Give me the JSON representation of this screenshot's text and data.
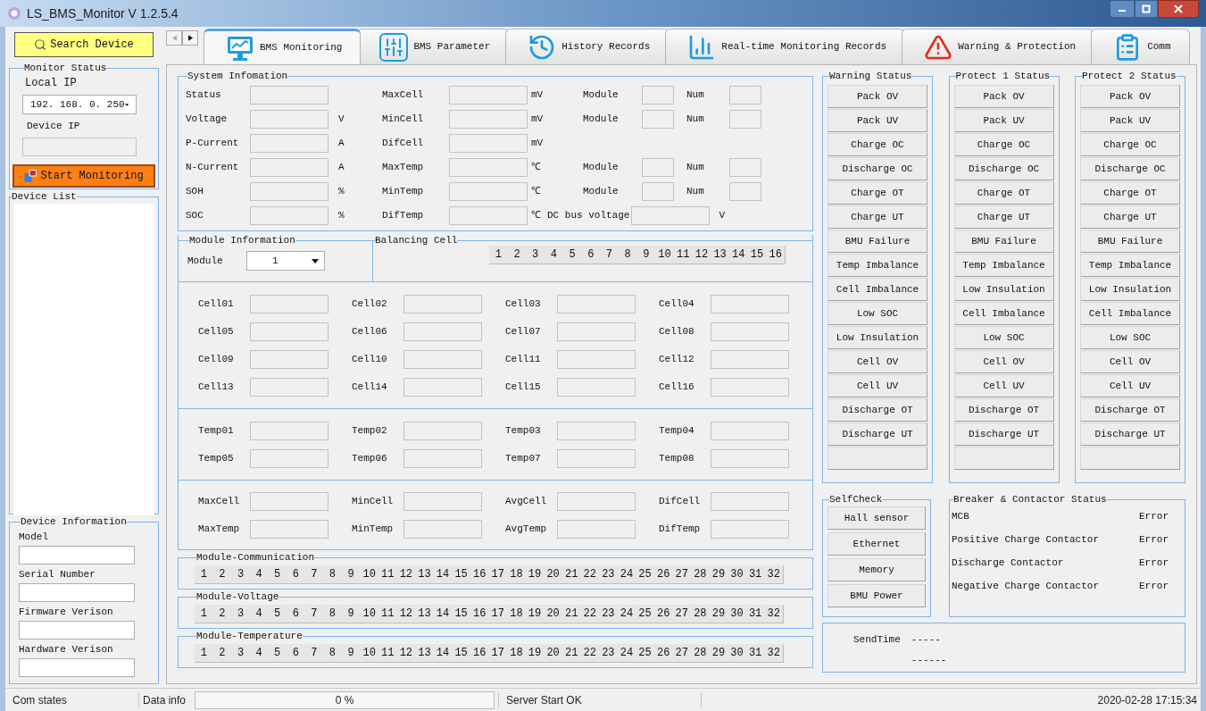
{
  "window": {
    "title": "LS_BMS_Monitor V 1.2.5.4"
  },
  "sidebar": {
    "search_button": "Search Device",
    "monitor_status": {
      "title": "Monitor Status",
      "local_ip_label": "Local IP",
      "local_ip": "192. 168. 0. 250",
      "device_ip_label": "Device IP",
      "start_button": "Start Monitoring"
    },
    "device_list": {
      "title": "Device List"
    },
    "device_information": {
      "title": "Device Information",
      "fields": [
        "Model",
        "Serial Number",
        "Firmware Verison",
        "Hardware Verison"
      ]
    }
  },
  "tabs": [
    {
      "label": "BMS Monitoring",
      "kind": "monitor",
      "selected": true
    },
    {
      "label": "BMS Parameter",
      "kind": "sliders",
      "selected": false
    },
    {
      "label": "History Records",
      "kind": "clock",
      "selected": false
    },
    {
      "label": "Real-time Monitoring Records",
      "kind": "chart",
      "selected": false
    },
    {
      "label": "Warning & Protection",
      "kind": "warning",
      "selected": false
    },
    {
      "label": "Comm",
      "kind": "clipboard",
      "selected": false
    }
  ],
  "system_information": {
    "title": "System Infomation",
    "rows": [
      {
        "label": "Status",
        "label_2": "MaxCell",
        "unit_2": "mV",
        "module_label": "Module",
        "num_label": "Num"
      },
      {
        "label": "Voltage",
        "unit": "V",
        "label_2": "MinCell",
        "unit_2": "mV",
        "module_label": "Module",
        "num_label": "Num"
      },
      {
        "label": "P-Current",
        "unit": "A",
        "label_2": "DifCell",
        "unit_2": "mV"
      },
      {
        "label": "N-Current",
        "unit": "A",
        "label_2": "MaxTemp",
        "unit_2": "℃",
        "module_label": "Module",
        "num_label": "Num"
      },
      {
        "label": "SOH",
        "unit": "%",
        "label_2": "MinTemp",
        "unit_2": "℃",
        "module_label": "Module",
        "num_label": "Num"
      },
      {
        "label": "SOC",
        "unit": "%",
        "label_2": "DifTemp",
        "unit_2": "℃",
        "bus_label": "DC bus voltage",
        "bus_unit": "V"
      }
    ]
  },
  "module_information": {
    "title": "Module Information",
    "module_label": "Module",
    "module_value": "1"
  },
  "balancing_cell": {
    "title": "Balancing Cell",
    "cells": [
      "1",
      "2",
      "3",
      "4",
      "5",
      "6",
      "7",
      "8",
      "9",
      "10",
      "11",
      "12",
      "13",
      "14",
      "15",
      "16"
    ]
  },
  "cells": [
    "Cell01",
    "Cell02",
    "Cell03",
    "Cell04",
    "Cell05",
    "Cell06",
    "Cell07",
    "Cell08",
    "Cell09",
    "Cell10",
    "Cell11",
    "Cell12",
    "Cell13",
    "Cell14",
    "Cell15",
    "Cell16"
  ],
  "temps": [
    "Temp01",
    "Temp02",
    "Temp03",
    "Temp04",
    "Temp05",
    "Temp06",
    "Temp07",
    "Temp08"
  ],
  "summary": [
    "MaxCell",
    "MinCell",
    "AvgCell",
    "DifCell",
    "MaxTemp",
    "MinTemp",
    "AvgTemp",
    "DifTemp"
  ],
  "module_strips": [
    {
      "title": "Module-Communication",
      "numbers": [
        "1",
        "2",
        "3",
        "4",
        "5",
        "6",
        "7",
        "8",
        "9",
        "10",
        "11",
        "12",
        "13",
        "14",
        "15",
        "16",
        "17",
        "18",
        "19",
        "20",
        "21",
        "22",
        "23",
        "24",
        "25",
        "26",
        "27",
        "28",
        "29",
        "30",
        "31",
        "32"
      ]
    },
    {
      "title": "Module-Voltage",
      "numbers": [
        "1",
        "2",
        "3",
        "4",
        "5",
        "6",
        "7",
        "8",
        "9",
        "10",
        "11",
        "12",
        "13",
        "14",
        "15",
        "16",
        "17",
        "18",
        "19",
        "20",
        "21",
        "22",
        "23",
        "24",
        "25",
        "26",
        "27",
        "28",
        "29",
        "30",
        "31",
        "32"
      ]
    },
    {
      "title": "Module-Temperature",
      "numbers": [
        "1",
        "2",
        "3",
        "4",
        "5",
        "6",
        "7",
        "8",
        "9",
        "10",
        "11",
        "12",
        "13",
        "14",
        "15",
        "16",
        "17",
        "18",
        "19",
        "20",
        "21",
        "22",
        "23",
        "24",
        "25",
        "26",
        "27",
        "28",
        "29",
        "30",
        "31",
        "32"
      ]
    }
  ],
  "status_columns": [
    {
      "title": "Warning Status",
      "items": [
        "Pack OV",
        "Pack UV",
        "Charge OC",
        "Discharge OC",
        "Charge OT",
        "Charge UT",
        "BMU Failure",
        "Temp Imbalance",
        "Cell Imbalance",
        "Low SOC",
        "Low Insulation",
        "Cell OV",
        "Cell UV",
        "Discharge OT",
        "Discharge UT"
      ]
    },
    {
      "title": "Protect 1 Status",
      "items": [
        "Pack OV",
        "Pack UV",
        "Charge OC",
        "Discharge OC",
        "Charge OT",
        "Charge UT",
        "BMU Failure",
        "Temp Imbalance",
        "Low Insulation",
        "Cell Imbalance",
        "Low SOC",
        "Cell OV",
        "Cell UV",
        "Discharge OT",
        "Discharge UT"
      ]
    },
    {
      "title": "Protect 2 Status",
      "items": [
        "Pack OV",
        "Pack UV",
        "Charge OC",
        "Discharge OC",
        "Charge OT",
        "Charge UT",
        "BMU Failure",
        "Temp Imbalance",
        "Low Insulation",
        "Cell Imbalance",
        "Low SOC",
        "Cell OV",
        "Cell UV",
        "Discharge OT",
        "Discharge UT"
      ]
    }
  ],
  "self_check": {
    "title": "SelfCheck",
    "buttons": [
      "Hall sensor",
      "Ethernet",
      "Memory",
      "BMU Power"
    ]
  },
  "breaker_status": {
    "title": "Breaker & Contactor Status",
    "rows": [
      {
        "name": "MCB",
        "status": "Error"
      },
      {
        "name": "Positive Charge Contactor",
        "status": "Error"
      },
      {
        "name": "Discharge Contactor",
        "status": "Error"
      },
      {
        "name": "Negative Charge Contactor",
        "status": "Error"
      }
    ]
  },
  "send_time": {
    "label": "SendTime",
    "line_1": "-----",
    "line_2": "------"
  },
  "status_bar": {
    "com_states": "Com states",
    "data_info": "Data info",
    "progress": "0 %",
    "server": "Server Start OK",
    "time": "2020-02-28 17:15:34"
  }
}
